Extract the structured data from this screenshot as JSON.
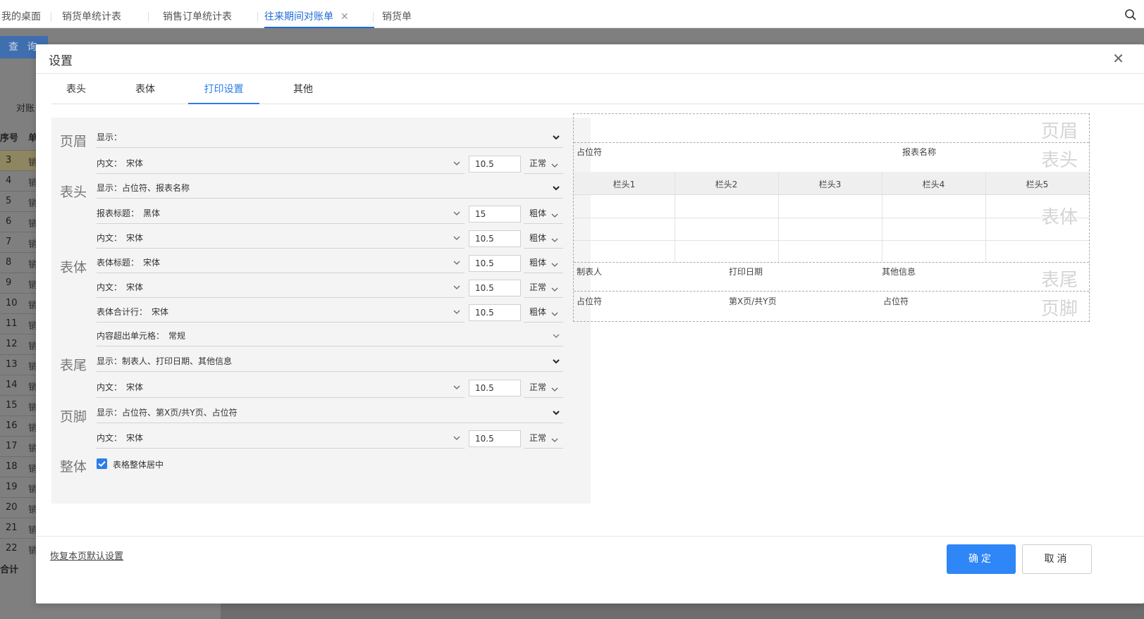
{
  "topbar": {
    "tabs": [
      {
        "label": "我的桌面"
      },
      {
        "label": "销货单统计表"
      },
      {
        "label": "销售订单统计表"
      },
      {
        "label": "往来期间对账单"
      },
      {
        "label": "销货单"
      }
    ],
    "active_tab": "往来期间对账单"
  },
  "background": {
    "query_button": "查 询",
    "side_label": "对账",
    "column_seq": "序号",
    "row_numbers": [
      "3",
      "4",
      "5",
      "6",
      "7",
      "8",
      "9",
      "10",
      "11",
      "12",
      "13",
      "14",
      "15",
      "16",
      "17",
      "18",
      "19",
      "20",
      "21",
      "22"
    ],
    "row_marker": "销",
    "total_label": "合计"
  },
  "dialog": {
    "title": "设置",
    "tabs": [
      "表头",
      "表体",
      "打印设置",
      "其他"
    ],
    "active_tab": "打印设置",
    "sections": {
      "header": "页眉",
      "table_head": "表头",
      "table_body": "表体",
      "table_tail": "表尾",
      "footer": "页脚",
      "whole": "整体"
    },
    "rows": {
      "header_show": {
        "label": "显示：",
        "value": ""
      },
      "header_content": {
        "label": "内文：",
        "font": "宋体",
        "size": "10.5",
        "weight": "正常"
      },
      "head_show": {
        "label": "显示：",
        "value": "占位符、报表名称"
      },
      "head_title": {
        "label": "报表标题：",
        "font": "黑体",
        "size": "15",
        "weight": "粗体"
      },
      "head_content": {
        "label": "内文：",
        "font": "宋体",
        "size": "10.5",
        "weight": "粗体"
      },
      "body_title": {
        "label": "表体标题：",
        "font": "宋体",
        "size": "10.5",
        "weight": "粗体"
      },
      "body_content": {
        "label": "内文：",
        "font": "宋体",
        "size": "10.5",
        "weight": "正常"
      },
      "body_total": {
        "label": "表体合计行：",
        "font": "宋体",
        "size": "10.5",
        "weight": "粗体"
      },
      "body_overflow": {
        "label": "内容超出单元格：",
        "value": "常规"
      },
      "tail_show": {
        "label": "显示：",
        "value": "制表人、打印日期、其他信息"
      },
      "tail_content": {
        "label": "内文：",
        "font": "宋体",
        "size": "10.5",
        "weight": "正常"
      },
      "footer_show": {
        "label": "显示：",
        "value": "占位符、第X页/共Y页、占位符"
      },
      "footer_content": {
        "label": "内文：",
        "font": "宋体",
        "size": "10.5",
        "weight": "正常"
      }
    },
    "whole_center": {
      "label": "表格整体居中",
      "checked": true
    },
    "preview": {
      "bands": {
        "header": "页眉",
        "table_head": "表头",
        "table_body": "表体",
        "table_tail": "表尾",
        "footer": "页脚"
      },
      "head_left": "占位符",
      "head_title": "报表名称",
      "columns": [
        "栏头1",
        "栏头2",
        "栏头3",
        "栏头4",
        "栏头5"
      ],
      "tail": [
        "制表人",
        "打印日期",
        "其他信息"
      ],
      "foot": [
        "占位符",
        "第X页/共Y页",
        "占位符"
      ]
    },
    "footer": {
      "restore_link": "恢复本页默认设置",
      "ok": "确定",
      "cancel": "取消"
    }
  },
  "colors": {
    "accent": "#2b7de9",
    "primary_button": "#2f86f6",
    "overlay": "#7f7f7f"
  }
}
